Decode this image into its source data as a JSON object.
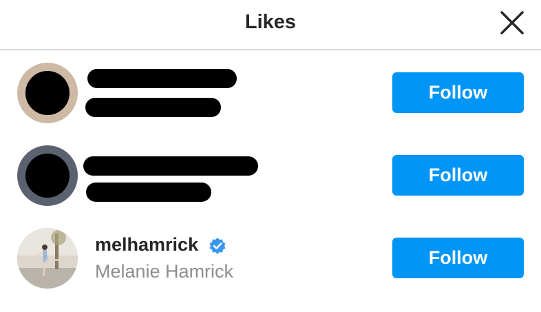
{
  "header": {
    "title": "Likes",
    "close_icon": "close-icon"
  },
  "likers": [
    {
      "username": "",
      "full_name": "",
      "redacted": true,
      "follow_label": "Follow"
    },
    {
      "username": "",
      "full_name": "",
      "redacted": true,
      "follow_label": "Follow"
    },
    {
      "username": "melhamrick",
      "full_name": "Melanie Hamrick",
      "verified": true,
      "verified_icon": "verified-badge-icon",
      "follow_label": "Follow"
    }
  ],
  "colors": {
    "follow_button": "#0095f6",
    "verified_badge": "#3897f0",
    "secondary_text": "#8e8e8e",
    "divider": "#dbdbdb"
  }
}
